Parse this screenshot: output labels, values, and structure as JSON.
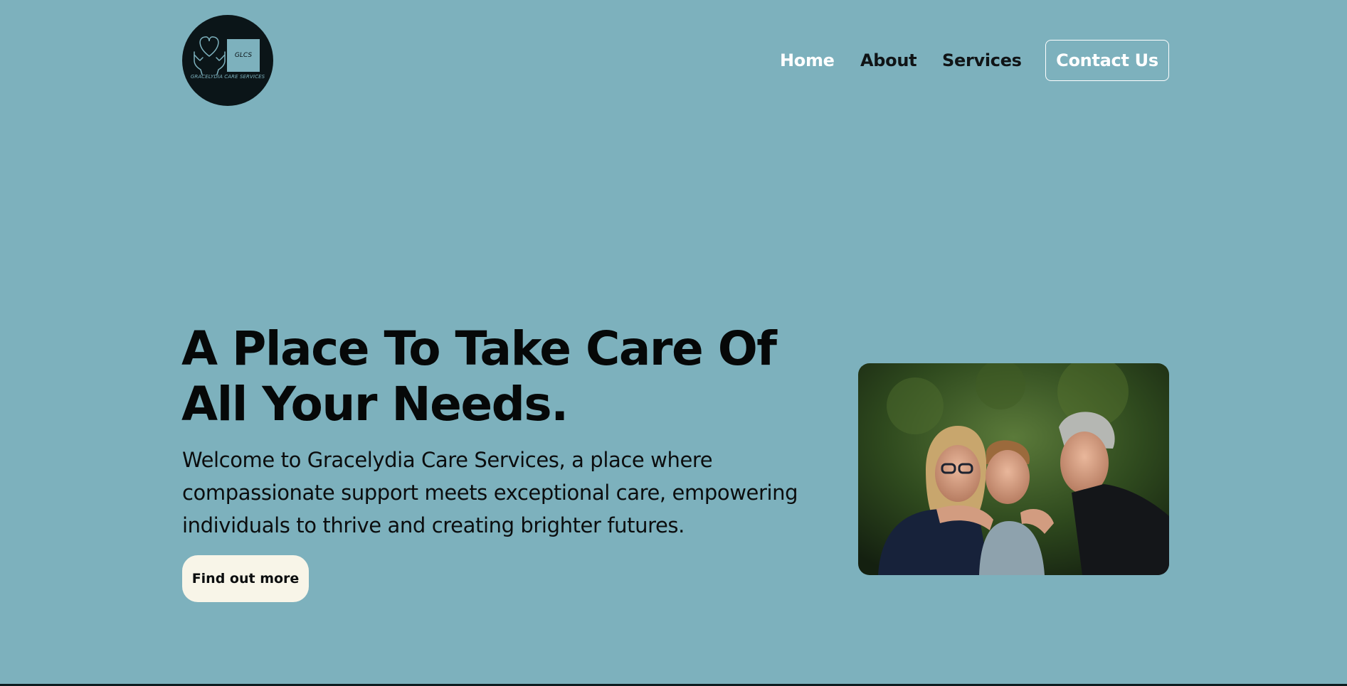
{
  "brand": {
    "logo_monogram": "GLCS",
    "logo_tagline": "GRACELYDIA CARE SERVICES",
    "logo_icon": "heart-in-hands-icon"
  },
  "nav": {
    "items": [
      {
        "label": "Home",
        "active": true
      },
      {
        "label": "About",
        "active": false
      },
      {
        "label": "Services",
        "active": false
      }
    ],
    "contact_label": "Contact Us"
  },
  "hero": {
    "title": "A Place To Take Care Of All Your Needs.",
    "description": "Welcome to Gracelydia Care Services, a place where compassionate support meets exceptional care, empowering individuals to thrive and creating brighter futures.",
    "cta_label": "Find out more"
  },
  "colors": {
    "background": "#7db1bd",
    "logo_background": "#0b1518",
    "cta_background": "#f8f5e8",
    "active_nav": "#ffffff",
    "text": "#060808"
  }
}
